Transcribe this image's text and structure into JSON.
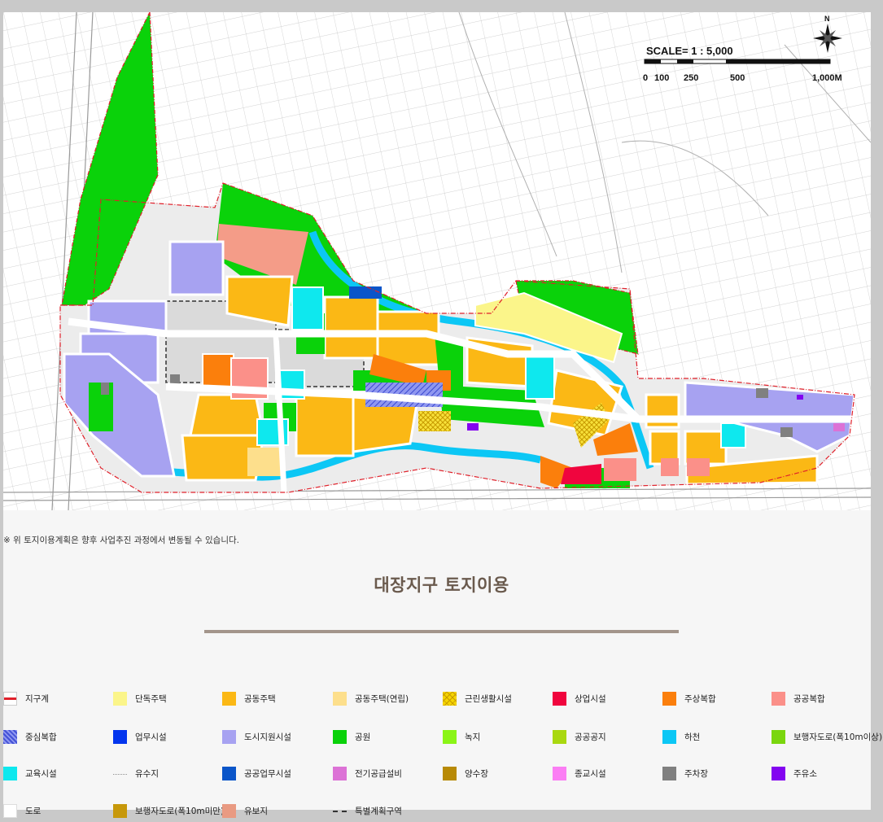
{
  "map": {
    "scale_label": "SCALE= 1 : 5,000",
    "scale_ticks": [
      "0",
      "100",
      "250",
      "500",
      "1,000M"
    ],
    "north_label": "N"
  },
  "note": "※ 위 토지이용계획은 향후 사업추진 과정에서 변동될 수 있습니다.",
  "title": "대장지구 토지이용",
  "legend": [
    {
      "label": "지구계",
      "color": "#e0202a",
      "style": "line"
    },
    {
      "label": "단독주택",
      "color": "#fbf58a",
      "style": "fill"
    },
    {
      "label": "공동주택",
      "color": "#fbb815",
      "style": "fill"
    },
    {
      "label": "공동주택(연립)",
      "color": "#fddf8c",
      "style": "fill"
    },
    {
      "label": "근린생활시설",
      "color": "#f5d500",
      "style": "hatch-cross"
    },
    {
      "label": "상업시설",
      "color": "#f0053e",
      "style": "fill"
    },
    {
      "label": "주상복합",
      "color": "#fb7f0c",
      "style": "fill"
    },
    {
      "label": "공공복합",
      "color": "#fb9089",
      "style": "fill"
    },
    {
      "label": "중심복합",
      "color": "#4352d6",
      "style": "hatch-diag"
    },
    {
      "label": "업무시설",
      "color": "#0335ee",
      "style": "fill"
    },
    {
      "label": "도시지원시설",
      "color": "#a7a2f1",
      "style": "fill"
    },
    {
      "label": "공원",
      "color": "#0ad20a",
      "style": "fill"
    },
    {
      "label": "녹지",
      "color": "#8bf517",
      "style": "fill"
    },
    {
      "label": "공공공지",
      "color": "#a9d810",
      "style": "fill"
    },
    {
      "label": "하천",
      "color": "#0cc7f5",
      "style": "fill"
    },
    {
      "label": "보행자도로(폭10m이상)",
      "color": "#7ad60e",
      "style": "fill"
    },
    {
      "label": "교육시설",
      "color": "#0ee8ee",
      "style": "fill"
    },
    {
      "label": "유수지",
      "color": "#8f8f8f",
      "style": "dotted"
    },
    {
      "label": "공공업무시설",
      "color": "#0a55c9",
      "style": "fill"
    },
    {
      "label": "전기공급설비",
      "color": "#dc72d6",
      "style": "fill"
    },
    {
      "label": "양수장",
      "color": "#b88a06",
      "style": "fill"
    },
    {
      "label": "종교시설",
      "color": "#fb7ef4",
      "style": "fill"
    },
    {
      "label": "주차장",
      "color": "#808080",
      "style": "fill"
    },
    {
      "label": "주유소",
      "color": "#8304f0",
      "style": "fill"
    },
    {
      "label": "도로",
      "color": "#ffffff",
      "style": "fill"
    },
    {
      "label": "보행자도로(폭10m미만)",
      "color": "#c7980a",
      "style": "fill"
    },
    {
      "label": "유보지",
      "color": "#e99a82",
      "style": "fill"
    },
    {
      "label": "특별계획구역",
      "color": "#333333",
      "style": "dashed"
    }
  ]
}
